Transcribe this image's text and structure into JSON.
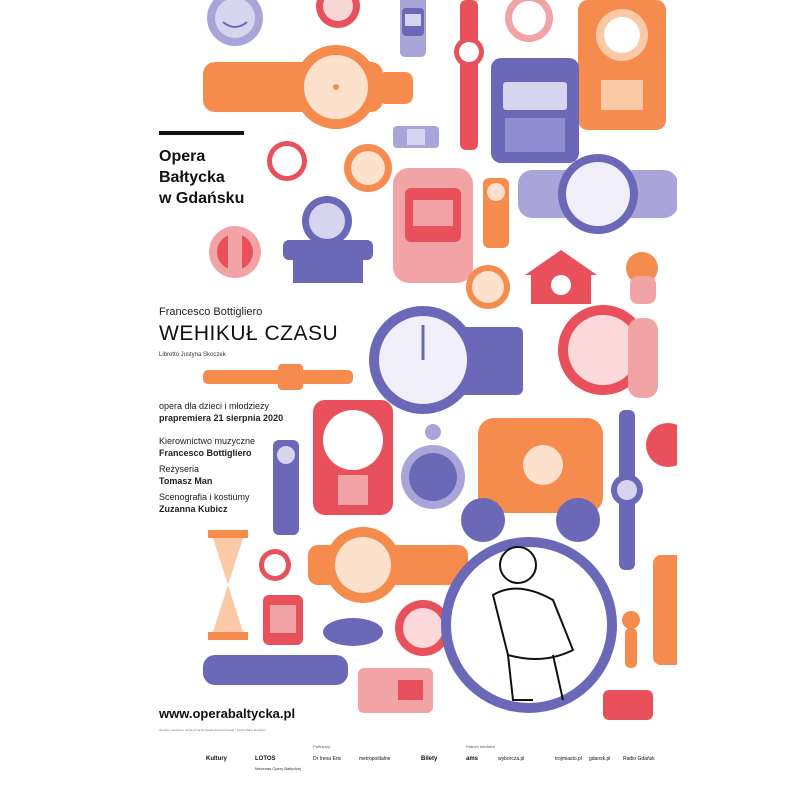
{
  "poster": {
    "institution": [
      "Opera",
      "Bałtycka",
      "w Gdańsku"
    ],
    "composer": "Francesco Bottigliero",
    "title": "WEHIKUŁ CZASU",
    "libretto": "Libretto Justyna Skoczek",
    "genre": "opera dla dzieci i młodzieży",
    "premiere": "prapremiera 21 sierpnia 2020",
    "credits": [
      {
        "role": "Kierownictwo muzyczne",
        "name": "Francesco Bottigliero"
      },
      {
        "role": "Reżyseria",
        "name": "Tomasz Man"
      },
      {
        "role": "Scenografia i kostiumy",
        "name": "Zuzanna Kubicz"
      }
    ],
    "website": "www.operabaltycka.pl",
    "fineprint": "dyrektor naczelna i artystyczna Romuald Wicza-Pokojski / Jacek Maria Fischlein",
    "sections": {
      "partners": "Partnerzy",
      "media": "Patroni medialni"
    },
    "sponsors": [
      "Kultury",
      "LOTOS",
      "Mecenas Opery Bałtyckiej",
      "Dr Irena Eris",
      "metropolitalne",
      "Bilety",
      "ams",
      "wyborcza.pl",
      "trojmiasto.pl",
      "gdansk.pl",
      "Radio Gdańsk"
    ]
  },
  "colors": {
    "orange": "#f58b4c",
    "purple": "#6b68b8",
    "red": "#e8505b",
    "lavender": "#a9a5d9",
    "pink": "#f2a3a6",
    "ink": "#111111"
  }
}
